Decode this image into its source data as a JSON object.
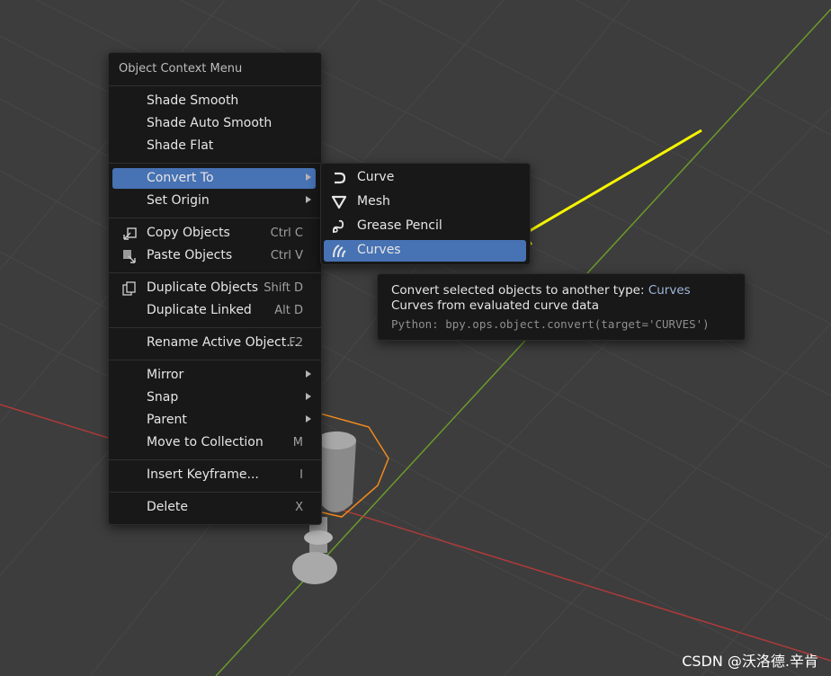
{
  "context_menu": {
    "title": "Object Context Menu",
    "items": [
      {
        "label": "Shade Smooth"
      },
      {
        "label": "Shade Auto Smooth"
      },
      {
        "label": "Shade Flat"
      },
      {
        "label": "Convert To",
        "submenu": true,
        "active": true
      },
      {
        "label": "Set Origin",
        "submenu": true
      },
      {
        "label": "Copy Objects",
        "shortcut": "Ctrl C",
        "icon": "copy-icon"
      },
      {
        "label": "Paste Objects",
        "shortcut": "Ctrl V",
        "icon": "paste-icon"
      },
      {
        "label": "Duplicate Objects",
        "shortcut": "Shift D",
        "icon": "duplicate-icon"
      },
      {
        "label": "Duplicate Linked",
        "shortcut": "Alt D"
      },
      {
        "label": "Rename Active Object...",
        "shortcut": "F2"
      },
      {
        "label": "Mirror",
        "submenu": true
      },
      {
        "label": "Snap",
        "submenu": true
      },
      {
        "label": "Parent",
        "submenu": true
      },
      {
        "label": "Move to Collection",
        "shortcut": "M"
      },
      {
        "label": "Insert Keyframe...",
        "shortcut": "I"
      },
      {
        "label": "Delete",
        "shortcut": "X"
      }
    ]
  },
  "convert_submenu": {
    "items": [
      {
        "label": "Curve",
        "icon": "curve-icon"
      },
      {
        "label": "Mesh",
        "icon": "mesh-icon"
      },
      {
        "label": "Grease Pencil",
        "icon": "grease-pencil-icon"
      },
      {
        "label": "Curves",
        "icon": "curves-icon",
        "active": true
      }
    ]
  },
  "tooltip": {
    "line1_prefix": "Convert selected objects to another type:",
    "line1_value": "Curves",
    "line2": "Curves from evaluated curve data",
    "python": "Python: bpy.ops.object.convert(target='CURVES')"
  },
  "watermark": "CSDN @沃洛德.辛肯",
  "colors": {
    "background": "#3d3d3d",
    "menu_bg": "#181818",
    "highlight": "#4772b3",
    "x_axis": "#b03a3a",
    "y_axis": "#6b9a2b",
    "selection_outline": "#f08a1c",
    "annotation_arrow": "#f5f500"
  }
}
